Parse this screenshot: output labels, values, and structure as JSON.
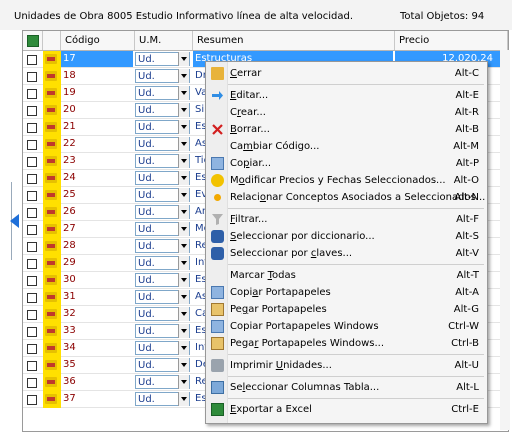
{
  "header": {
    "title": "Unidades de Obra 8005 Estudio Informativo línea de alta velocidad.",
    "total": "Total Objetos: 94"
  },
  "columns": {
    "code": "Código",
    "um": "U.M.",
    "summary": "Resumen",
    "price": "Precio"
  },
  "rows": [
    {
      "code": "17",
      "um": "Ud.",
      "summary": "Estructuras",
      "price": "12.020,24"
    },
    {
      "code": "18",
      "um": "Ud.",
      "summary": "Dre"
    },
    {
      "code": "19",
      "um": "Ud.",
      "summary": "Val"
    },
    {
      "code": "20",
      "um": "Ud.",
      "summary": "Sin"
    },
    {
      "code": "21",
      "um": "Ud.",
      "summary": "Est"
    },
    {
      "code": "22",
      "um": "Ud.",
      "summary": "Asi"
    },
    {
      "code": "23",
      "um": "Ud.",
      "summary": "Tie"
    },
    {
      "code": "24",
      "um": "Ud.",
      "summary": "Est"
    },
    {
      "code": "25",
      "um": "Ud.",
      "summary": "Eva"
    },
    {
      "code": "26",
      "um": "Ud.",
      "summary": "Ani"
    },
    {
      "code": "27",
      "um": "Ud.",
      "summary": "Me"
    },
    {
      "code": "28",
      "um": "Ud.",
      "summary": "Rev"
    },
    {
      "code": "29",
      "um": "Ud.",
      "summary": "Inf"
    },
    {
      "code": "30",
      "um": "Ud.",
      "summary": "Est"
    },
    {
      "code": "31",
      "um": "Ud.",
      "summary": "Asi"
    },
    {
      "code": "32",
      "um": "Ud.",
      "summary": "Ca"
    },
    {
      "code": "33",
      "um": "Ud.",
      "summary": "Est"
    },
    {
      "code": "34",
      "um": "Ud.",
      "summary": "Inf"
    },
    {
      "code": "35",
      "um": "Ud.",
      "summary": "De"
    },
    {
      "code": "36",
      "um": "Ud.",
      "summary": "Rep"
    },
    {
      "code": "37",
      "um": "Ud.",
      "summary": "Est"
    }
  ],
  "menu": {
    "items": [
      {
        "pre": "",
        "u": "C",
        "post": "errar",
        "shortcut": "Alt-C",
        "icon": "folder-icon"
      },
      {
        "pre": "",
        "u": "E",
        "post": "ditar...",
        "shortcut": "Alt-E",
        "icon": "arrow-right-icon"
      },
      {
        "pre": "C",
        "u": "r",
        "post": "ear...",
        "shortcut": "Alt-R",
        "icon": ""
      },
      {
        "pre": "",
        "u": "B",
        "post": "orrar...",
        "shortcut": "Alt-B",
        "icon": "delete-x-icon"
      },
      {
        "pre": "Ca",
        "u": "m",
        "post": "biar Código...",
        "shortcut": "Alt-M",
        "icon": ""
      },
      {
        "pre": "Co",
        "u": "p",
        "post": "iar...",
        "shortcut": "Alt-P",
        "icon": "copy-icon"
      },
      {
        "pre": "M",
        "u": "o",
        "post": "dificar Precios y Fechas Seleccionados...",
        "shortcut": "Alt-O",
        "icon": "clock-icon"
      },
      {
        "pre": "Relaci",
        "u": "o",
        "post": "nar Conceptos Asociados a Seleccionados...",
        "shortcut": "Alt-N",
        "icon": "dot-icon"
      },
      {
        "pre": "",
        "u": "F",
        "post": "iltrar...",
        "shortcut": "Alt-F",
        "icon": "filter-icon"
      },
      {
        "pre": "",
        "u": "S",
        "post": "eleccionar por diccionario...",
        "shortcut": "Alt-S",
        "icon": "binoculars-icon"
      },
      {
        "pre": "Seleccionar por ",
        "u": "c",
        "post": "laves...",
        "shortcut": "Alt-V",
        "icon": "binoculars-icon"
      },
      {
        "pre": "Marcar ",
        "u": "T",
        "post": "odas",
        "shortcut": "Alt-T",
        "icon": ""
      },
      {
        "pre": "Copi",
        "u": "a",
        "post": "r Portapapeles",
        "shortcut": "Alt-A",
        "icon": "copy-icon"
      },
      {
        "pre": "Pe",
        "u": "g",
        "post": "ar Portapapeles",
        "shortcut": "Alt-G",
        "icon": "paste-icon"
      },
      {
        "pre": "Copiar Portapapeles Windows",
        "u": "",
        "post": "",
        "shortcut": "Ctrl-W",
        "icon": "copy-icon"
      },
      {
        "pre": "Pega",
        "u": "r",
        "post": " Portapapeles Windows...",
        "shortcut": "Ctrl-B",
        "icon": "paste-icon"
      },
      {
        "pre": "Imprimir ",
        "u": "U",
        "post": "nidades...",
        "shortcut": "Alt-U",
        "icon": "printer-icon"
      },
      {
        "pre": "Se",
        "u": "l",
        "post": "eccionar Columnas Tabla...",
        "shortcut": "Alt-L",
        "icon": "columns-icon"
      },
      {
        "pre": "",
        "u": "E",
        "post": "xportar a Excel",
        "shortcut": "Ctrl-E",
        "icon": "excel-icon"
      }
    ]
  }
}
